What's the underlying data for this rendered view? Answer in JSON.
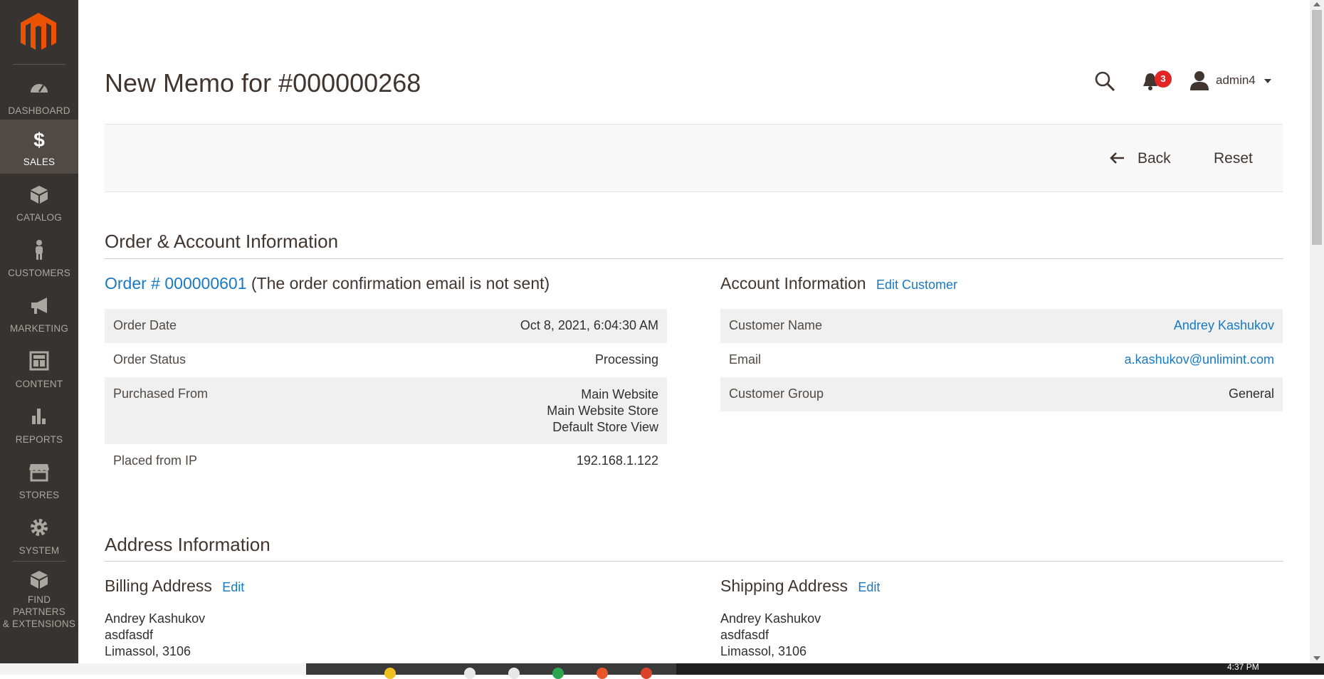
{
  "sidebar": {
    "items": [
      {
        "label": "DASHBOARD",
        "icon": "dashboard-icon"
      },
      {
        "label": "SALES",
        "icon": "dollar-icon"
      },
      {
        "label": "CATALOG",
        "icon": "cube-icon"
      },
      {
        "label": "CUSTOMERS",
        "icon": "person-icon"
      },
      {
        "label": "MARKETING",
        "icon": "megaphone-icon"
      },
      {
        "label": "CONTENT",
        "icon": "layout-icon"
      },
      {
        "label": "REPORTS",
        "icon": "bar-chart-icon"
      },
      {
        "label": "STORES",
        "icon": "store-icon"
      },
      {
        "label": "SYSTEM",
        "icon": "gear-icon"
      },
      {
        "label_line1": "FIND PARTNERS",
        "label_line2": "& EXTENSIONS",
        "icon": "blocks-icon"
      }
    ],
    "active": "SALES"
  },
  "header": {
    "title": "New Memo for #000000268",
    "notifications_count": "3",
    "user_name": "admin4"
  },
  "actions": {
    "back_label": "Back",
    "reset_label": "Reset"
  },
  "order_account": {
    "section_title": "Order & Account Information",
    "order_link": "Order # 000000601",
    "order_note": "(The order confirmation email is not sent)",
    "rows": [
      {
        "label": "Order Date",
        "value": "Oct 8, 2021, 6:04:30 AM"
      },
      {
        "label": "Order Status",
        "value": "Processing"
      },
      {
        "label": "Purchased From",
        "value_lines": [
          "Main Website",
          "Main Website Store",
          "Default Store View"
        ]
      },
      {
        "label": "Placed from IP",
        "value": "192.168.1.122"
      }
    ],
    "account_title": "Account Information",
    "edit_customer_label": "Edit Customer",
    "account_rows": [
      {
        "label": "Customer Name",
        "value": "Andrey Kashukov"
      },
      {
        "label": "Email",
        "value": "a.kashukov@unlimint.com"
      },
      {
        "label": "Customer Group",
        "value": "General"
      }
    ]
  },
  "address": {
    "section_title": "Address Information",
    "billing_title": "Billing Address",
    "shipping_title": "Shipping Address",
    "edit_label": "Edit",
    "billing_lines": [
      "Andrey Kashukov",
      "asdfasdf",
      "Limassol, 3106"
    ],
    "shipping_lines": [
      "Andrey Kashukov",
      "asdfasdf",
      "Limassol, 3106"
    ]
  },
  "taskbar": {
    "time": "4:37 PM"
  },
  "colors": {
    "sidebar_bg": "#373330",
    "sidebar_active": "#514943",
    "brand_orange": "#eb5202",
    "link": "#1979c3",
    "badge": "#e22626"
  }
}
